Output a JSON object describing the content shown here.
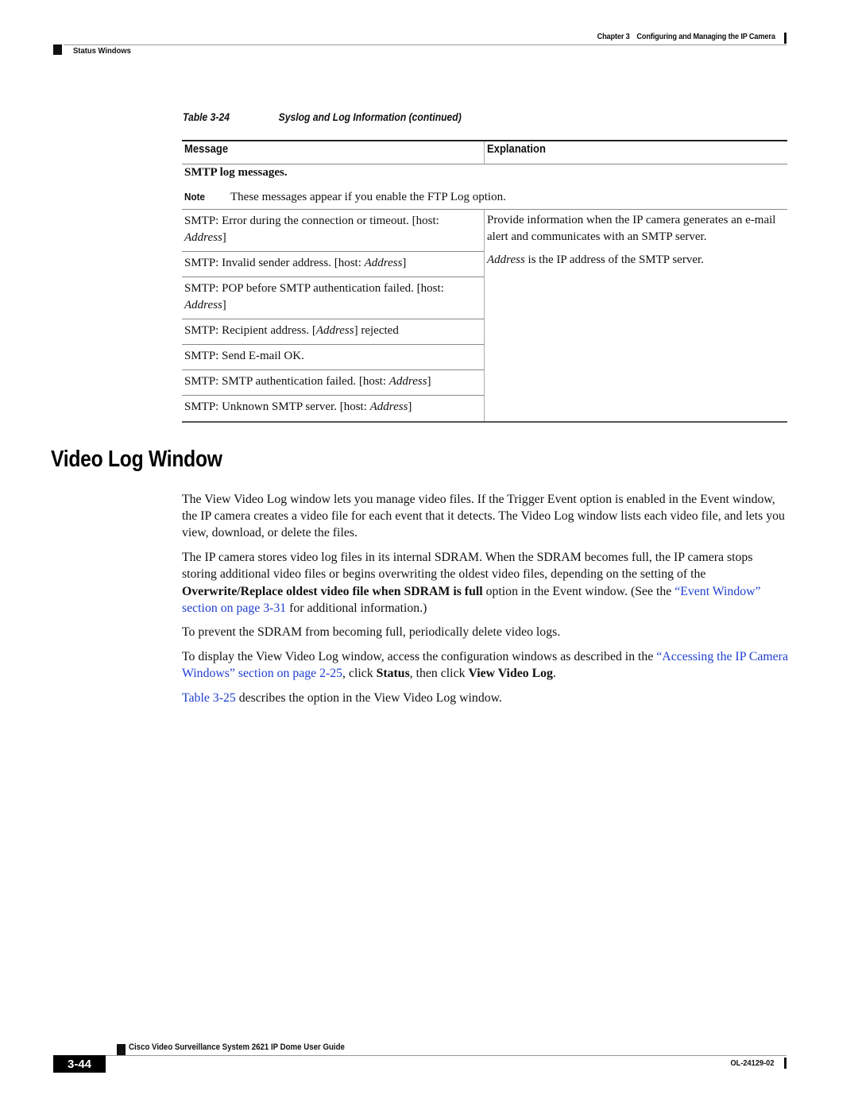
{
  "header": {
    "chapter_label": "Chapter 3",
    "chapter_title": "Configuring and Managing the IP Camera",
    "section": "Status Windows"
  },
  "table": {
    "caption_number": "Table 3-24",
    "caption_title": "Syslog and Log Information (continued)",
    "columns": [
      "Message",
      "Explanation"
    ],
    "group_title": "SMTP log messages.",
    "note_label": "Note",
    "note_text": "These messages appear if you enable the FTP Log option.",
    "rows": [
      {
        "pre": "SMTP: Error during the connection or timeout. [host: ",
        "em": "Address",
        "post": "]"
      },
      {
        "pre": "SMTP: Invalid sender address. [host: ",
        "em": "Address",
        "post": "]"
      },
      {
        "pre": "SMTP: POP before SMTP authentication failed. [host: ",
        "em": "Address",
        "post": "]"
      },
      {
        "pre": "SMTP: Recipient address. [",
        "em": "Address",
        "post": "] rejected"
      },
      {
        "pre": "SMTP: Send E-mail OK.",
        "em": "",
        "post": ""
      },
      {
        "pre": "SMTP: SMTP authentication failed. [host: ",
        "em": "Address",
        "post": "]"
      },
      {
        "pre": "SMTP: Unknown SMTP server. [host: ",
        "em": "Address",
        "post": "]"
      }
    ],
    "explanation": {
      "p1": "Provide information when the IP camera generates an e-mail alert and communicates with an SMTP server.",
      "p2_em": "Address",
      "p2_rest": " is the IP address of the SMTP server."
    }
  },
  "section": {
    "title": "Video Log Window",
    "p1": "The View Video Log window lets you manage video files. If the Trigger Event option is enabled in the Event window, the IP camera creates a video file for each event that it detects. The Video Log window lists each video file, and lets you view, download, or delete the files.",
    "p2_a": "The IP camera stores video log files in its internal SDRAM. When the SDRAM becomes full, the IP camera stops storing additional video files or begins overwriting the oldest video files, depending on the setting of the ",
    "p2_bold": "Overwrite/Replace oldest video file when SDRAM is full",
    "p2_b": " option in the Event window. (See the ",
    "p2_link": "“Event Window” section on page 3-31",
    "p2_c": " for additional information.)",
    "p3": "To prevent the SDRAM from becoming full, periodically delete video logs.",
    "p4_a": "To display the View Video Log window, access the configuration windows as described in the ",
    "p4_link": "“Accessing the IP Camera Windows” section on page 2-25",
    "p4_b": ", click ",
    "p4_bold1": "Status",
    "p4_c": ", then click ",
    "p4_bold2": "View Video Log",
    "p4_d": ".",
    "p5_link": "Table 3-25",
    "p5_rest": " describes the option in the View Video Log window."
  },
  "footer": {
    "guide_title": "Cisco Video Surveillance System 2621 IP Dome User Guide",
    "page_number": "3-44",
    "doc_number": "OL-24129-02"
  },
  "colors": {
    "link": "#1f3fd0",
    "text": "#111111"
  }
}
